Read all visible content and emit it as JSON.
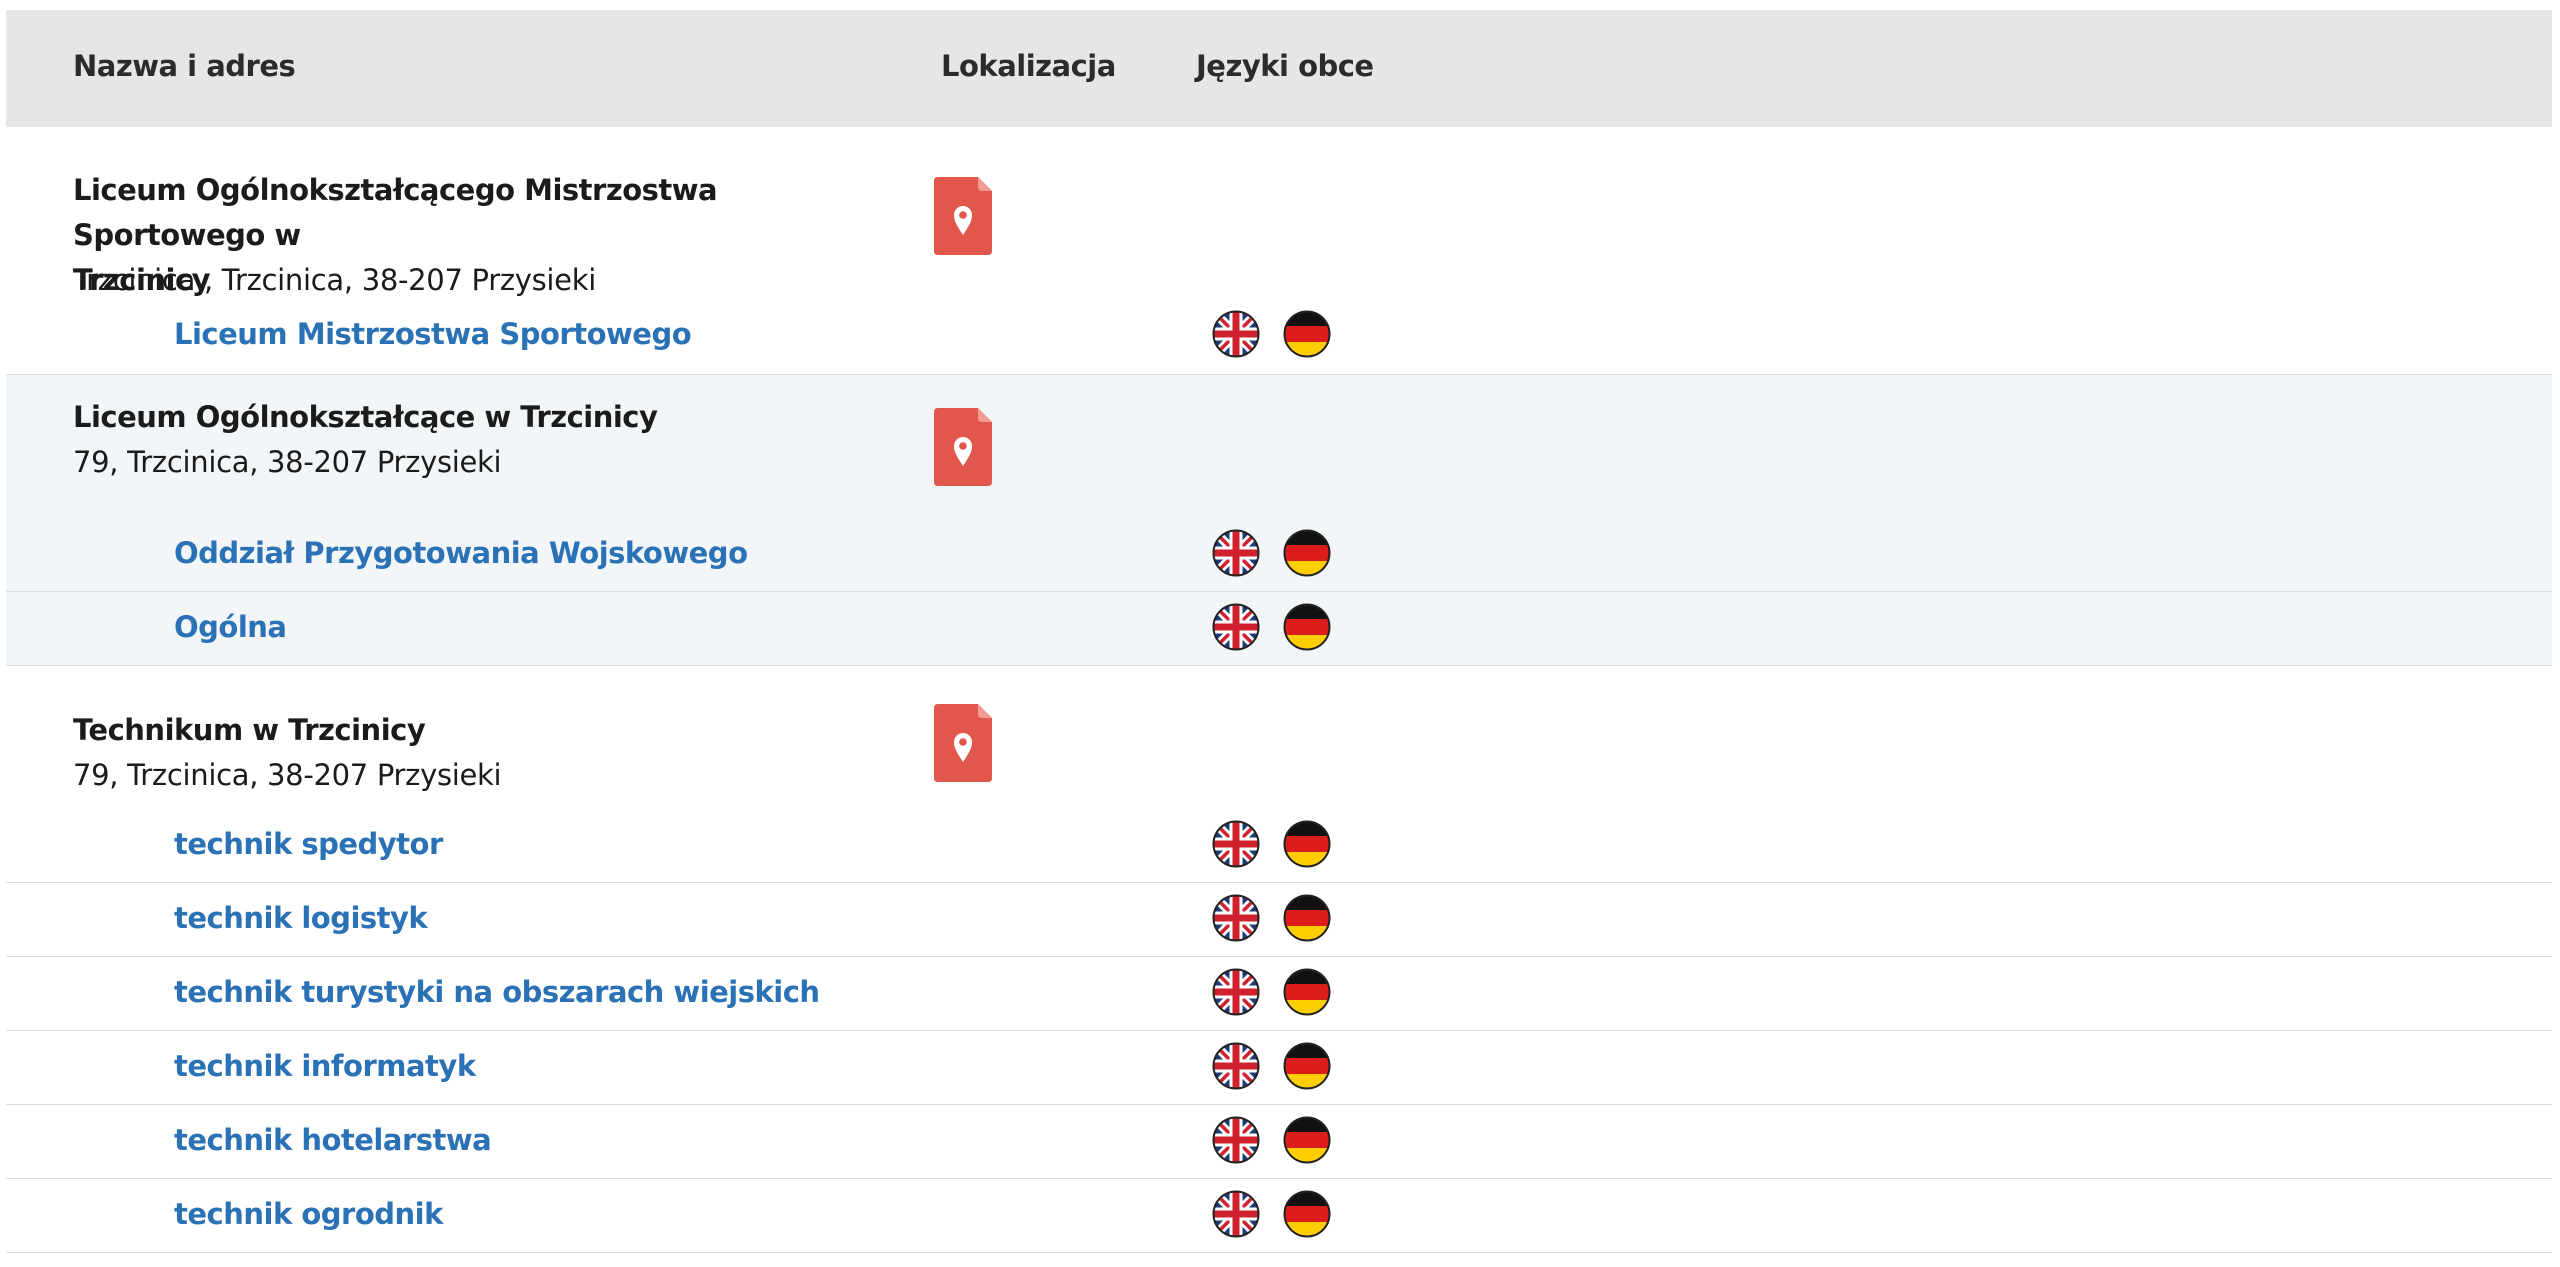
{
  "table": {
    "headers": {
      "name": "Nazwa i adres",
      "location": "Lokalizacja",
      "languages": "Języki obce"
    },
    "schools": [
      {
        "name_line1": "Liceum Ogólnokształcącego Mistrzostwa Sportowego w",
        "name_line2": "Trzcinicy",
        "address": "Trzcinica , Trzcinica, 38-207 Przysieki",
        "programs": [
          {
            "name": "Liceum Mistrzostwa Sportowego",
            "languages": [
              "english-flag-icon",
              "german-flag-icon"
            ]
          }
        ]
      },
      {
        "name_line1": "Liceum Ogólnokształcące w Trzcinicy",
        "address": "79, Trzcinica, 38-207 Przysieki",
        "programs": [
          {
            "name": "Oddział Przygotowania Wojskowego",
            "languages": [
              "english-flag-icon",
              "german-flag-icon"
            ]
          },
          {
            "name": "Ogólna",
            "languages": [
              "english-flag-icon",
              "german-flag-icon"
            ]
          }
        ]
      },
      {
        "name_line1": "Technikum w Trzcinicy",
        "address": "79, Trzcinica, 38-207 Przysieki",
        "programs": [
          {
            "name": "technik spedytor",
            "languages": [
              "english-flag-icon",
              "german-flag-icon"
            ]
          },
          {
            "name": "technik logistyk",
            "languages": [
              "english-flag-icon",
              "german-flag-icon"
            ]
          },
          {
            "name": "technik turystyki na obszarach wiejskich",
            "languages": [
              "english-flag-icon",
              "german-flag-icon"
            ]
          },
          {
            "name": "technik informatyk",
            "languages": [
              "english-flag-icon",
              "german-flag-icon"
            ]
          },
          {
            "name": "technik hotelarstwa",
            "languages": [
              "english-flag-icon",
              "german-flag-icon"
            ]
          },
          {
            "name": "technik ogrodnik",
            "languages": [
              "english-flag-icon",
              "german-flag-icon"
            ]
          }
        ]
      }
    ]
  },
  "colors": {
    "header_bg": "#e6e6e6",
    "link": "#2a72b5",
    "alt_row_bg": "#f3f6f9",
    "map_marker": "#e2574c"
  },
  "icons": {
    "location": "map-marker-icon"
  }
}
